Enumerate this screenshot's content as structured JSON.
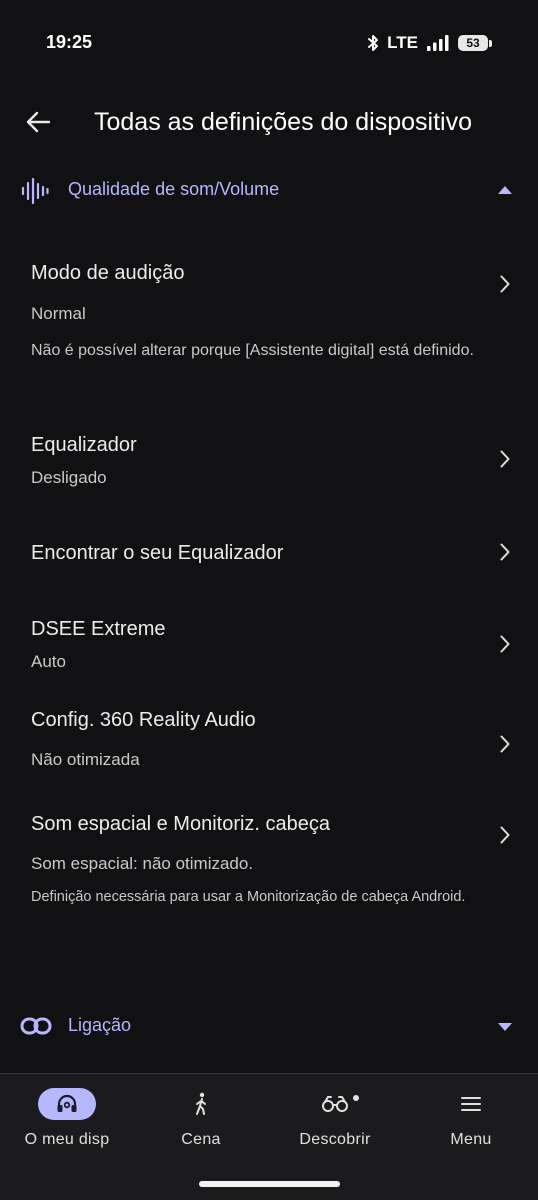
{
  "status_bar": {
    "time": "19:25",
    "network": "LTE",
    "battery": "53"
  },
  "header": {
    "title": "Todas as definições do dispositivo"
  },
  "section_sound": {
    "title": "Qualidade de som/Volume",
    "expanded": true
  },
  "items": [
    {
      "title": "Modo de audição",
      "subtitle": "Normal",
      "note": "Não é possível alterar porque [Assistente digital] está definido."
    },
    {
      "title": "Equalizador",
      "subtitle": "Desligado"
    },
    {
      "title": "Encontrar o seu Equalizador"
    },
    {
      "title": "DSEE Extreme",
      "subtitle": "Auto"
    },
    {
      "title": "Config. 360 Reality Audio",
      "subtitle": "Não otimizada"
    },
    {
      "title": "Som espacial e Monitoriz. cabeça",
      "subtitle": "Som espacial: não otimizado.",
      "note": "Definição necessária para usar a Monitorização de cabeça Android."
    }
  ],
  "section_connection": {
    "title": "Ligação",
    "expanded": false
  },
  "bottom_nav": [
    {
      "label": "O meu disp",
      "icon": "headphones-icon",
      "active": true
    },
    {
      "label": "Cena",
      "icon": "walking-person-icon"
    },
    {
      "label": "Descobrir",
      "icon": "binoculars-icon"
    },
    {
      "label": "Menu",
      "icon": "hamburger-menu-icon"
    }
  ],
  "colors": {
    "background": "#111113",
    "accent": "#b6b7ff",
    "nav_background": "#1b1b1e"
  }
}
